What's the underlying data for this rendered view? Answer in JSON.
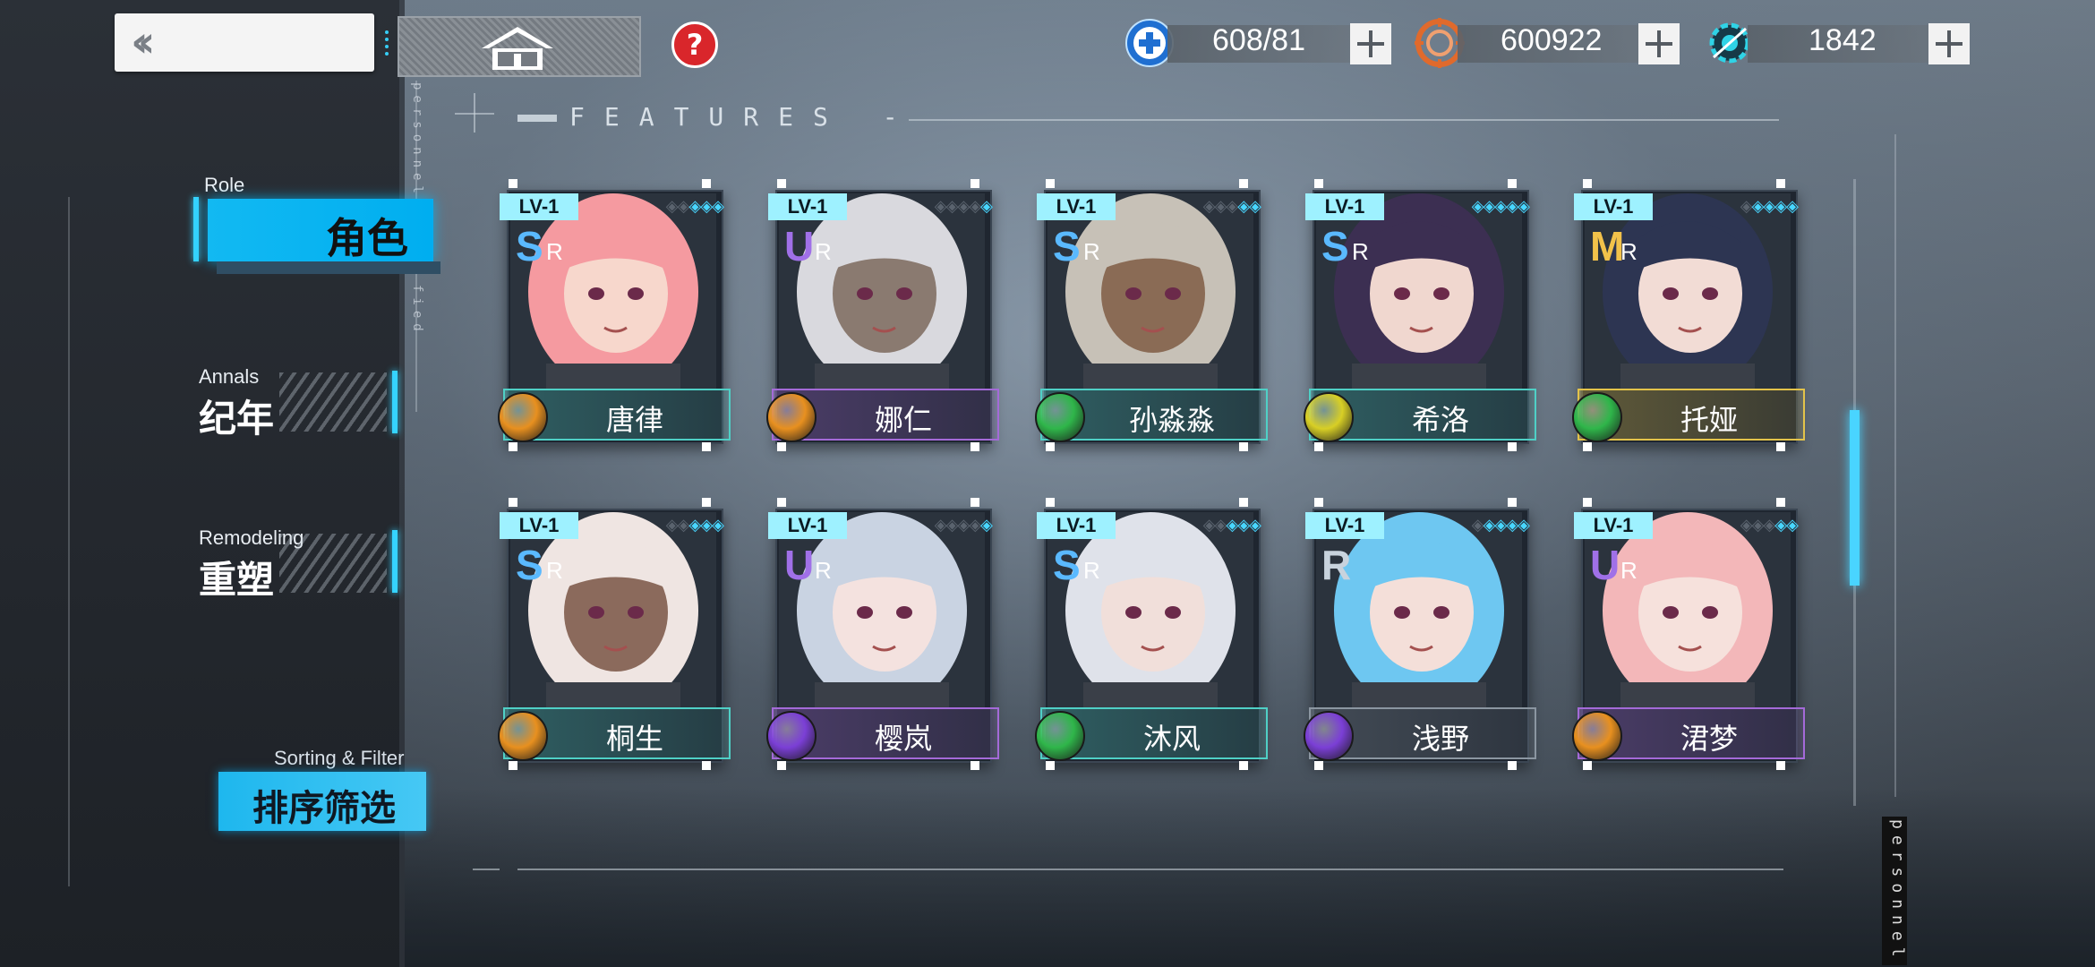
{
  "topbar": {
    "back_icon": "double-chevron-left-icon",
    "home_icon": "home-icon",
    "help_icon": "question-icon",
    "help_glyph": "?",
    "resources": [
      {
        "id": "stamina",
        "icon": "stamina-plus-icon",
        "value": "608/81",
        "color": "#1f6fd1"
      },
      {
        "id": "gold",
        "icon": "gold-ring-icon",
        "value": "600922",
        "color": "#e06a2c"
      },
      {
        "id": "crystal",
        "icon": "crystal-gear-icon",
        "value": "1842",
        "color": "#2fd3e6"
      }
    ]
  },
  "features_title": "FEATURES -",
  "side_text": {
    "top": "personnel",
    "top_extra": "fied",
    "bottom": "personnel"
  },
  "nav": {
    "role": {
      "en": "Role",
      "zh": "角色"
    },
    "annals": {
      "en": "Annals",
      "zh": "纪年"
    },
    "remodel": {
      "en": "Remodeling",
      "zh": "重塑"
    },
    "sort": {
      "en": "Sorting & Filter",
      "zh": "排序筛选"
    }
  },
  "accent_color": "#12b9f2",
  "characters": [
    {
      "name": "唐律",
      "level": "LV-1",
      "rarity_big": "S",
      "rarity_small": "R",
      "stars_on": 3,
      "stars_total": 5,
      "element": "lightning",
      "element_color": "#e8901f",
      "bar_color": "#4fd0c6",
      "hair": "#f59aa0",
      "skin": "#f7d7cc"
    },
    {
      "name": "娜仁",
      "level": "LV-1",
      "rarity_big": "U",
      "rarity_small": "R",
      "stars_on": 1,
      "stars_total": 5,
      "element": "lightning",
      "element_color": "#e8901f",
      "bar_color": "#a46ad8",
      "hair": "#d9d9de",
      "skin": "#8a7a70"
    },
    {
      "name": "孙淼淼",
      "level": "LV-1",
      "rarity_big": "S",
      "rarity_small": "R",
      "stars_on": 2,
      "stars_total": 5,
      "element": "nature",
      "element_color": "#2fb64a",
      "bar_color": "#4fd0c6",
      "hair": "#c7c1b7",
      "skin": "#8a6b55"
    },
    {
      "name": "希洛",
      "level": "LV-1",
      "rarity_big": "S",
      "rarity_small": "R",
      "stars_on": 5,
      "stars_total": 5,
      "element": "light",
      "element_color": "#d8cf25",
      "bar_color": "#4fd0c6",
      "hair": "#3c2f52",
      "skin": "#f0d7cf"
    },
    {
      "name": "托娅",
      "level": "LV-1",
      "rarity_big": "M",
      "rarity_small": "R",
      "stars_on": 4,
      "stars_total": 5,
      "element": "nature",
      "element_color": "#2fb64a",
      "bar_color": "#e3c34a",
      "hair": "#2d3552",
      "skin": "#f2dcd5"
    },
    {
      "name": "桐生",
      "level": "LV-1",
      "rarity_big": "S",
      "rarity_small": "R",
      "stars_on": 3,
      "stars_total": 5,
      "element": "lightning",
      "element_color": "#e8901f",
      "bar_color": "#4fd0c6",
      "hair": "#efe5e2",
      "skin": "#8b6a5c"
    },
    {
      "name": "樱岚",
      "level": "LV-1",
      "rarity_big": "U",
      "rarity_small": "R",
      "stars_on": 1,
      "stars_total": 5,
      "element": "void",
      "element_color": "#7b3fd6",
      "bar_color": "#a46ad8",
      "hair": "#c9d3e2",
      "skin": "#f4e2df"
    },
    {
      "name": "沐风",
      "level": "LV-1",
      "rarity_big": "S",
      "rarity_small": "R",
      "stars_on": 3,
      "stars_total": 5,
      "element": "nature",
      "element_color": "#2fb64a",
      "bar_color": "#4fd0c6",
      "hair": "#dfe2ea",
      "skin": "#f1dfda"
    },
    {
      "name": "浅野",
      "level": "LV-1",
      "rarity_big": "R",
      "rarity_small": "",
      "stars_on": 4,
      "stars_total": 5,
      "element": "void",
      "element_color": "#7b3fd6",
      "bar_color": "#8b96a1",
      "hair": "#6ec7f1",
      "skin": "#f4dfd9"
    },
    {
      "name": "涒梦",
      "level": "LV-1",
      "rarity_big": "U",
      "rarity_small": "R",
      "stars_on": 2,
      "stars_total": 5,
      "element": "lightning",
      "element_color": "#e8901f",
      "bar_color": "#a46ad8",
      "hair": "#f3b7b9",
      "skin": "#f6e1dc"
    }
  ]
}
